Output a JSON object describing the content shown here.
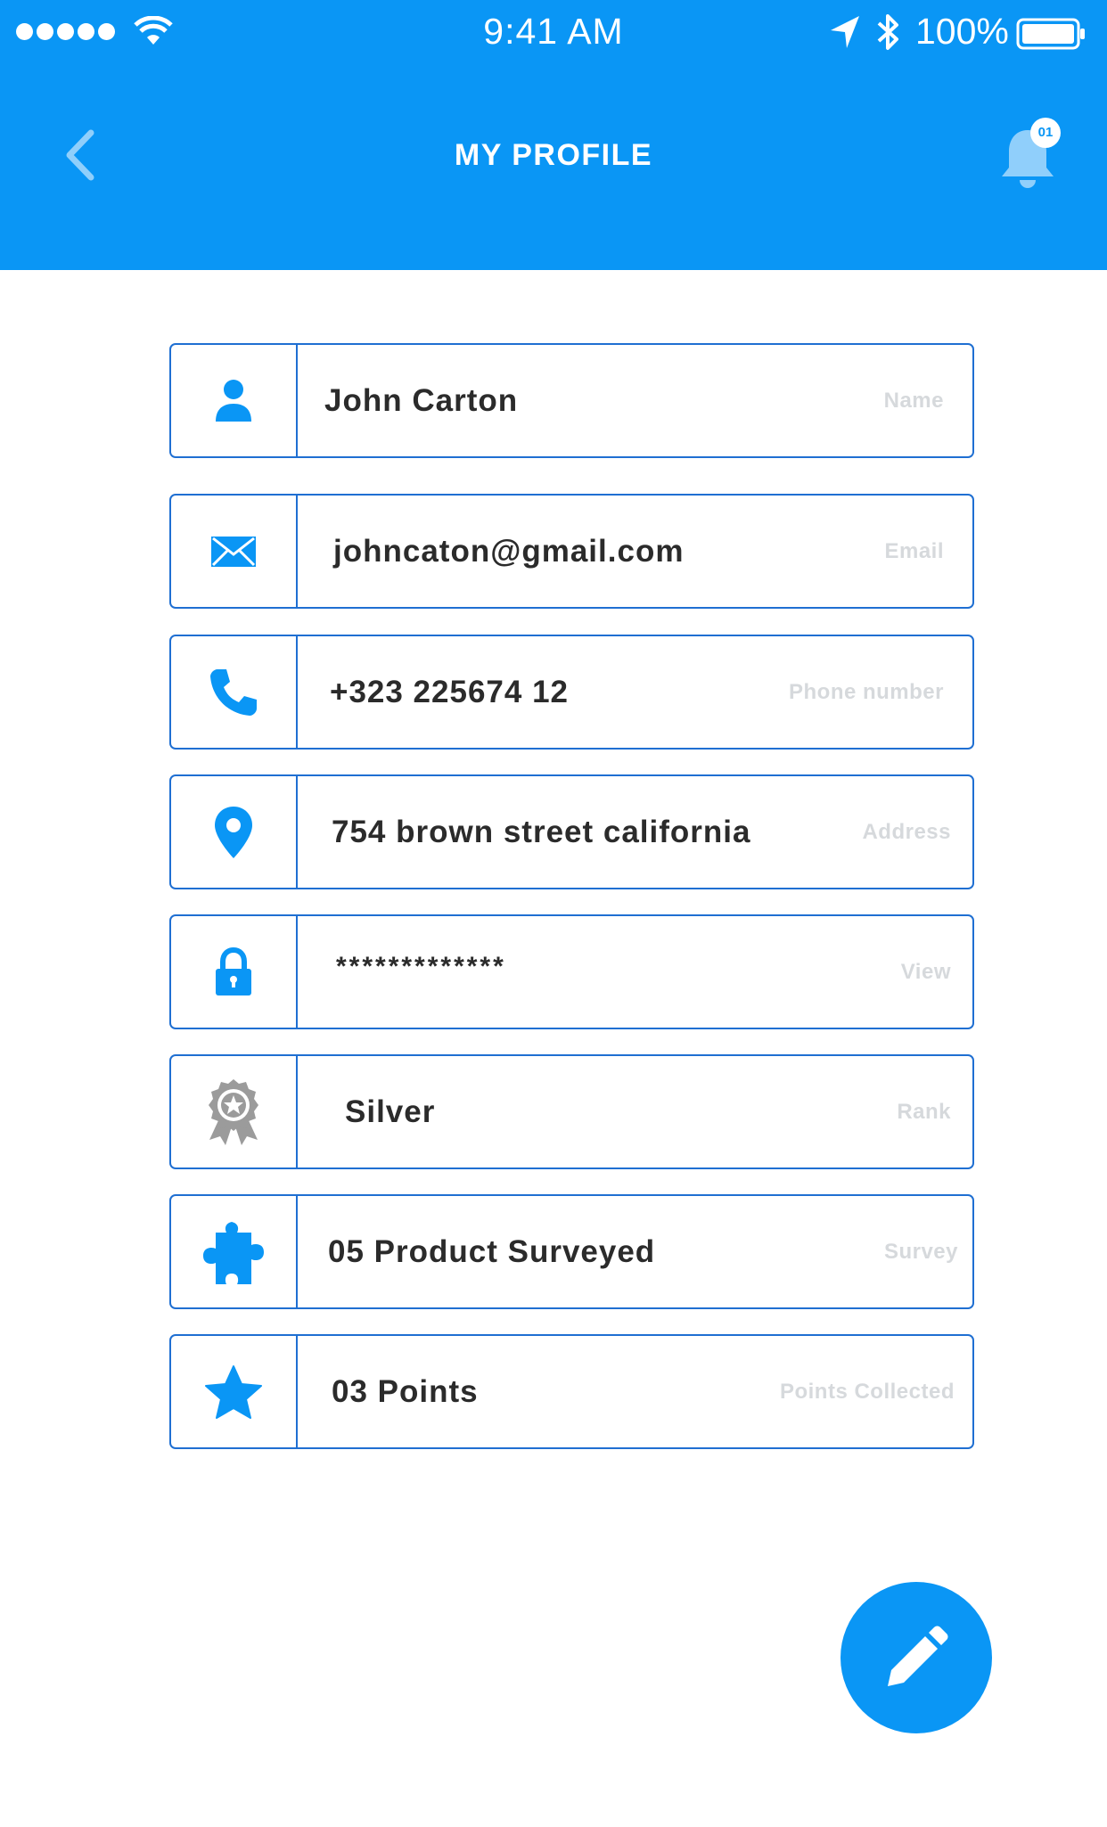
{
  "status_bar": {
    "time": "9:41 AM",
    "battery": "100%"
  },
  "header": {
    "title": "MY PROFILE",
    "notification_count": "01"
  },
  "fields": [
    {
      "icon": "person-icon",
      "value": "John Carton",
      "label": "Name"
    },
    {
      "icon": "mail-icon",
      "value": "johncaton@gmail.com",
      "label": "Email"
    },
    {
      "icon": "phone-icon",
      "value": "+323 225674 12",
      "label": "Phone number"
    },
    {
      "icon": "location-pin-icon",
      "value": "754 brown street california",
      "label": "Address"
    },
    {
      "icon": "lock-icon",
      "value": "*************",
      "label": "View"
    },
    {
      "icon": "award-ribbon-icon",
      "value": "Silver",
      "label": "Rank"
    },
    {
      "icon": "puzzle-piece-icon",
      "value": "05 Product Surveyed",
      "label": "Survey"
    },
    {
      "icon": "star-icon",
      "value": "03 Points",
      "label": "Points Collected"
    }
  ],
  "colors": {
    "primary": "#0a96f5",
    "border": "#1f6fd2",
    "label": "#d6d9dc",
    "value_text": "#2b2b2b",
    "rank_icon": "#9b9b9b"
  },
  "fab": {
    "icon": "pencil-icon"
  }
}
